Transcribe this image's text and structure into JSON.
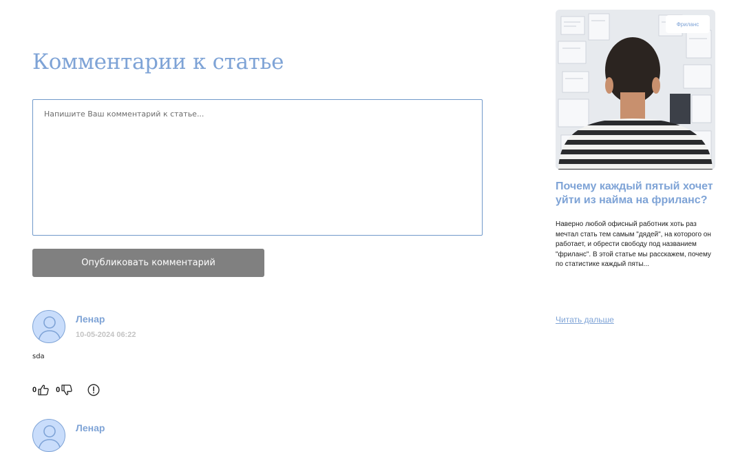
{
  "comments_section": {
    "title": "Комментарии к статье",
    "textarea_placeholder": "Напишите Ваш комментарий к статье...",
    "publish_label": "Опубликовать комментарий"
  },
  "comments": [
    {
      "author": "Ленар",
      "date": "10-05-2024 06:22",
      "text": "sda",
      "likes": "0",
      "dislikes": "0"
    },
    {
      "author": "Ленар"
    }
  ],
  "sidebar_card": {
    "badge": "Фриланс",
    "title": "Почему каждый пятый хочет уйти из найма на фриланс?",
    "excerpt": "Наверно любой офисный работник хоть раз мечтал стать тем самым \"дядей\", на которого он работает, и обрести свободу под названием \"фриланс\". В этой статье мы расскажем, почему по статистике каждый пяты...",
    "read_more": "Читать дальше"
  },
  "colors": {
    "accent": "#7ea3d6",
    "button_gray": "#808080",
    "avatar_bg": "#c9ddfb",
    "date_gray": "#c3c3c3"
  },
  "icons": [
    "person-avatar-icon",
    "thumbs-up-icon",
    "thumbs-down-icon",
    "exclamation-circle-icon"
  ]
}
